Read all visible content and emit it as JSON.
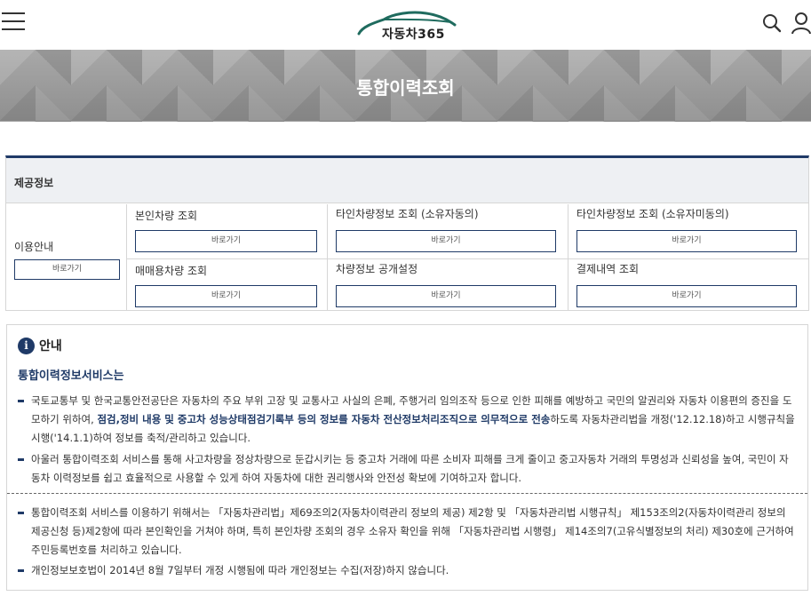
{
  "header": {
    "logo_text": "자동차365",
    "menu_icon": "hamburger-menu-icon",
    "search_icon": "search-icon",
    "user_icon": "user-icon",
    "logo_color": "#1f6b5e"
  },
  "banner": {
    "title": "통합이력조회"
  },
  "provided_info": {
    "heading": "제공정보",
    "guide": {
      "label": "이용안내",
      "button": "바로가기"
    },
    "items": [
      {
        "label": "본인차량 조회",
        "button": "바로가기"
      },
      {
        "label": "타인차량정보 조회 (소유자동의)",
        "button": "바로가기"
      },
      {
        "label": "타인차량정보 조회 (소유자미동의)",
        "button": "바로가기"
      },
      {
        "label": "매매용차량 조회",
        "button": "바로가기"
      },
      {
        "label": "차량정보 공개설정",
        "button": "바로가기"
      },
      {
        "label": "결제내역 조회",
        "button": "바로가기"
      }
    ]
  },
  "notice": {
    "heading": "안내",
    "icon_letter": "i",
    "service_title": "통합이력정보서비스는",
    "para1_a": "국토교통부 및 한국교통안전공단은 자동차의 주요 부위 고장 및 교통사고 사실의 은폐, 주행거리 임의조작 등으로 인한 피해를 예방하고 국민의 알권리와 자동차 이용편의 증진을 도모하기 위하여, ",
    "para1_b": "점검,정비 내용 및 중고차 성능상태점검기록부 등의 정보를 자동차 전산정보처리조직으로 의무적으로 전송",
    "para1_c": "하도록 자동차관리법을 개정('12.12.18)하고 시행규칙을 시행('14.1.1)하여 정보를 축적/관리하고 있습니다.",
    "para2": "아울러 통합이력조회 서비스를 통해 사고차량을 정상차량으로 둔갑시키는 등 중고차 거래에 따른 소비자 피해를 크게 줄이고 중고자동차 거래의 투명성과 신뢰성을 높여, 국민이 자동차 이력정보를 쉽고 효율적으로 사용할 수 있게 하여 자동차에 대한 권리행사와 안전성 확보에 기여하고자 합니다.",
    "para3": "통합이력조회 서비스를 이용하기 위해서는 「자동차관리법」제69조의2(자동차이력관리 정보의 제공) 제2항 및 「자동차관리법 시행규칙」 제153조의2(자동차이력관리 정보의 제공신청 등)제2항에 따라 본인확인을 거쳐야 하며, 특히 본인차량 조회의 경우 소유자 확인을 위해 「자동차관리법 시행령」 제14조의7(고유식별정보의 처리) 제30호에 근거하여 주민등록번호를 처리하고 있습니다.",
    "para4": "개인정보보호법이 2014년 8월 7일부터 개정 시행됨에 따라 개인정보는 수집(저장)하지 않습니다."
  }
}
